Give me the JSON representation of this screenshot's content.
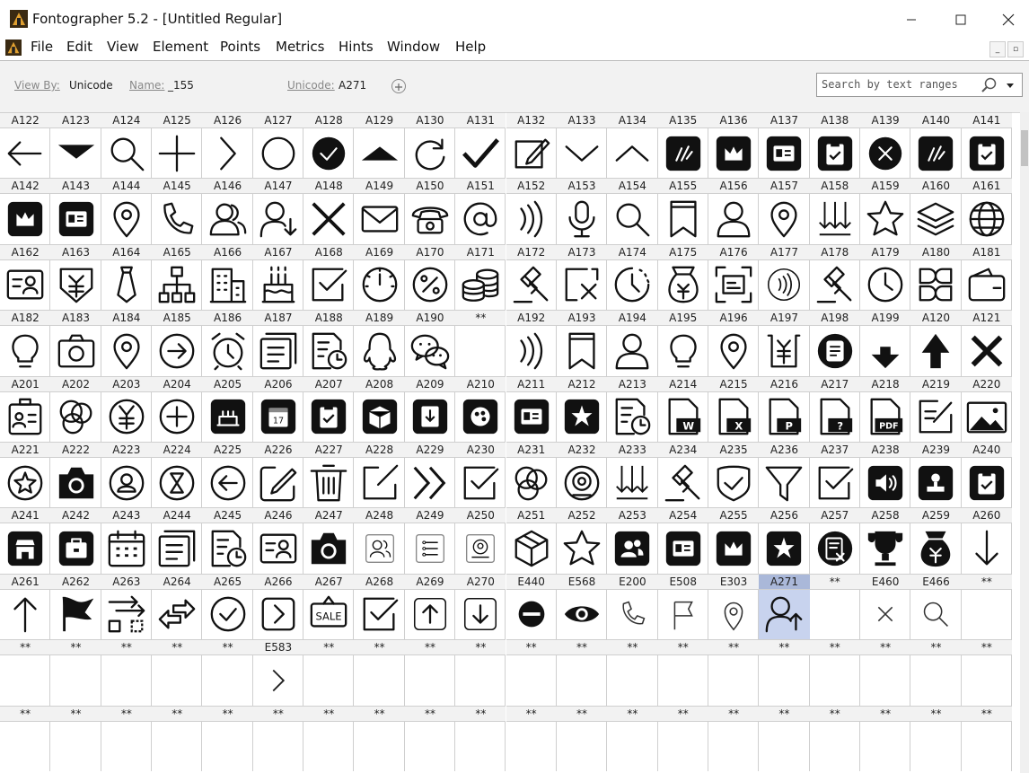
{
  "window": {
    "title": "Fontographer 5.2 - [Untitled Regular]",
    "app_icon": "fontographer-icon",
    "controls": [
      "minimize-icon",
      "maximize-icon",
      "close-icon"
    ]
  },
  "menu": [
    "File",
    "Edit",
    "View",
    "Element",
    "Points",
    "Metrics",
    "Hints",
    "Window",
    "Help"
  ],
  "toolbar": {
    "view_by_label": "View By:",
    "view_by_value": "Unicode",
    "name_label": "Name:",
    "name_value": "_155",
    "unicode_label": "Unicode:",
    "unicode_value": "A271",
    "search_placeholder": "Search by text ranges",
    "search_icon": "search-icon",
    "add_icon": "plus-circle-icon"
  },
  "colors": {
    "selected_label": "#aab8d9",
    "selected_cell": "#c8d3ee",
    "header_bg": "#f2f2f2"
  },
  "selected_unicode": "A271",
  "glyph_rows": [
    {
      "labels": [
        "A122",
        "A123",
        "A124",
        "A125",
        "A126",
        "A127",
        "A128",
        "A129",
        "A130",
        "A131",
        "A132",
        "A133",
        "A134",
        "A135",
        "A136",
        "A137",
        "A138",
        "A139",
        "A140",
        "A141"
      ],
      "icons": [
        "arrow-left",
        "caret-down",
        "search",
        "plus",
        "chevron-right",
        "circle",
        "check-circle-filled",
        "caret-up",
        "refresh",
        "check",
        "edit",
        "chevron-down",
        "chevron-up",
        "badge-filled",
        "crown-filled",
        "id-card-filled",
        "clipboard-filled",
        "close-circle-filled",
        "badge-filled",
        "clipboard-filled"
      ]
    },
    {
      "labels": [
        "A142",
        "A143",
        "A144",
        "A145",
        "A146",
        "A147",
        "A148",
        "A149",
        "A150",
        "A151",
        "A152",
        "A153",
        "A154",
        "A155",
        "A156",
        "A157",
        "A158",
        "A159",
        "A160",
        "A161"
      ],
      "icons": [
        "crown-filled",
        "id-card-filled",
        "location",
        "phone",
        "users",
        "user-down",
        "close",
        "mail",
        "telephone",
        "at",
        "nfc",
        "microphone",
        "search",
        "bookmark",
        "user",
        "location",
        "sort-down",
        "star",
        "layers",
        "globe"
      ]
    },
    {
      "labels": [
        "A162",
        "A163",
        "A164",
        "A165",
        "A166",
        "A167",
        "A168",
        "A169",
        "A170",
        "A171",
        "A172",
        "A173",
        "A174",
        "A175",
        "A176",
        "A177",
        "A178",
        "A179",
        "A180",
        "A181"
      ],
      "icons": [
        "id-user",
        "yuan-shield",
        "tie",
        "org-chart",
        "building",
        "birthday-cake",
        "checkbox",
        "dashboard",
        "percent",
        "coins",
        "auction",
        "close-square",
        "clock-dashed",
        "money-bag",
        "scan",
        "nfc-circle",
        "auction",
        "clock",
        "apps",
        "wallet"
      ]
    },
    {
      "labels": [
        "A182",
        "A183",
        "A184",
        "A185",
        "A186",
        "A187",
        "A188",
        "A189",
        "A190",
        "**",
        "A192",
        "A193",
        "A194",
        "A195",
        "A196",
        "A197",
        "A198",
        "A199",
        "A120",
        "A121"
      ],
      "icons": [
        "bulb",
        "camera",
        "location",
        "arrow-circle-right",
        "alarm",
        "stack",
        "file-clock",
        "qq",
        "wechat",
        "",
        "nfc",
        "bookmark",
        "user",
        "bulb",
        "location",
        "yuan-doc",
        "list-circle-filled",
        "download-arrow",
        "upload-arrow",
        "close-bold"
      ]
    },
    {
      "labels": [
        "A201",
        "A202",
        "A203",
        "A204",
        "A205",
        "A206",
        "A207",
        "A208",
        "A209",
        "A210",
        "A211",
        "A212",
        "A213",
        "A214",
        "A215",
        "A216",
        "A217",
        "A218",
        "A219",
        "A220"
      ],
      "icons": [
        "id-badge",
        "circles",
        "yuan-circle",
        "plus-circle",
        "cake-filled",
        "calendar-filled",
        "clipboard-filled",
        "box-filled",
        "download-filled",
        "palette-filled",
        "id-card-filled",
        "star-filled-square",
        "file-clock",
        "file-word",
        "file-excel",
        "file-ppt",
        "file-question",
        "file-pdf",
        "note-edit",
        "image"
      ]
    },
    {
      "labels": [
        "A221",
        "A222",
        "A223",
        "A224",
        "A225",
        "A226",
        "A227",
        "A228",
        "A229",
        "A230",
        "A231",
        "A232",
        "A233",
        "A234",
        "A235",
        "A236",
        "A237",
        "A238",
        "A239",
        "A240"
      ],
      "icons": [
        "star-circle",
        "camera-filled",
        "user-circle",
        "hourglass-circle",
        "arrow-circle-left",
        "edit-square",
        "trash",
        "edit-corner",
        "chevron-double-right",
        "checkbox",
        "circles",
        "target",
        "sort-down",
        "auction",
        "shield-check",
        "filter",
        "checkbox",
        "speaker-filled",
        "stamp-filled",
        "clipboard-filled"
      ]
    },
    {
      "labels": [
        "A241",
        "A242",
        "A243",
        "A244",
        "A245",
        "A246",
        "A247",
        "A248",
        "A249",
        "A250",
        "A251",
        "A252",
        "A253",
        "A254",
        "A255",
        "A256",
        "A257",
        "A258",
        "A259",
        "A260"
      ],
      "icons": [
        "store-filled",
        "briefcase-filled",
        "calendar-grid",
        "stack",
        "file-clock",
        "id-user",
        "camera-filled",
        "users-light",
        "list-light",
        "stamp-light",
        "box",
        "star",
        "users-filled",
        "id-card-filled",
        "crown-filled",
        "star-filled-square",
        "file-close-filled",
        "trophy",
        "money-bag-filled",
        "arrow-down"
      ]
    },
    {
      "labels": [
        "A261",
        "A262",
        "A263",
        "A264",
        "A265",
        "A266",
        "A267",
        "A268",
        "A269",
        "A270",
        "E440",
        "E568",
        "E200",
        "E508",
        "E303",
        "A271",
        "**",
        "E460",
        "E466",
        "**"
      ],
      "icons": [
        "arrow-up",
        "flag-filled",
        "shuffle-boxes",
        "transfer",
        "check-circle",
        "chevron-square",
        "sale-sign",
        "checkbox",
        "arrow-up-square",
        "arrow-down-square",
        "minus-circle-filled",
        "eye",
        "phone-light",
        "flag-light",
        "location-light",
        "user-up",
        "",
        "close-light",
        "search-light",
        ""
      ]
    },
    {
      "labels": [
        "**",
        "**",
        "**",
        "**",
        "**",
        "E583",
        "**",
        "**",
        "**",
        "**",
        "**",
        "**",
        "**",
        "**",
        "**",
        "**",
        "**",
        "**",
        "**",
        "**"
      ],
      "icons": [
        "",
        "",
        "",
        "",
        "",
        "chevron-right-light",
        "",
        "",
        "",
        "",
        "",
        "",
        "",
        "",
        "",
        "",
        "",
        "",
        "",
        ""
      ]
    },
    {
      "labels": [
        "**",
        "**",
        "**",
        "**",
        "**",
        "**",
        "**",
        "**",
        "**",
        "**",
        "**",
        "**",
        "**",
        "**",
        "**",
        "**",
        "**",
        "**",
        "**",
        "**"
      ],
      "icons": [
        "",
        "",
        "",
        "",
        "",
        "",
        "",
        "",
        "",
        "",
        "",
        "",
        "",
        "",
        "",
        "",
        "",
        "",
        "",
        ""
      ]
    }
  ]
}
